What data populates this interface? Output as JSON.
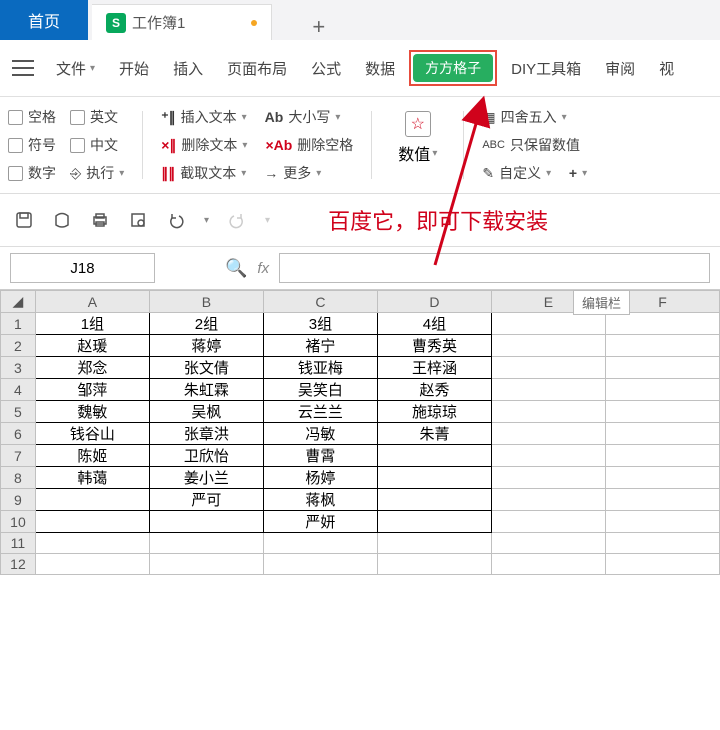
{
  "tabs": {
    "home": "首页",
    "workbook": "工作簿1"
  },
  "menu": {
    "file": "文件",
    "items": [
      "开始",
      "插入",
      "页面布局",
      "公式",
      "数据"
    ],
    "highlighted": "方方格子",
    "rest": [
      "DIY工具箱",
      "审阅",
      "视"
    ]
  },
  "ribbon": {
    "col1": [
      "空格",
      "英文"
    ],
    "col1b": [
      "符号",
      "中文"
    ],
    "col1c": [
      "数字",
      "执行"
    ],
    "col2": [
      "插入文本",
      "大小写"
    ],
    "col2b": [
      "删除文本",
      "删除空格"
    ],
    "col2c": [
      "截取文本",
      "更多"
    ],
    "col3": {
      "main": "数值"
    },
    "col4": [
      "四舍五入",
      "只保留数值",
      "自定义"
    ]
  },
  "annotation": "百度它，即可下载安装",
  "nameBox": "J18",
  "fx": "fx",
  "tooltip": "编辑栏",
  "columns": [
    "A",
    "B",
    "C",
    "D",
    "E",
    "F"
  ],
  "rows": [
    "1",
    "2",
    "3",
    "4",
    "5",
    "6",
    "7",
    "8",
    "9",
    "10",
    "11",
    "12"
  ],
  "data": [
    [
      "1组",
      "2组",
      "3组",
      "4组",
      "",
      ""
    ],
    [
      "赵瑗",
      "蒋婷",
      "褚宁",
      "曹秀英",
      "",
      ""
    ],
    [
      "郑念",
      "张文倩",
      "钱亚梅",
      "王梓涵",
      "",
      ""
    ],
    [
      "邹萍",
      "朱虹霖",
      "吴笑白",
      "赵秀",
      "",
      ""
    ],
    [
      "魏敏",
      "吴枫",
      "云兰兰",
      "施琼琼",
      "",
      ""
    ],
    [
      "钱谷山",
      "张章洪",
      "冯敏",
      "朱菁",
      "",
      ""
    ],
    [
      "陈姬",
      "卫欣怡",
      "曹霄",
      "",
      "",
      ""
    ],
    [
      "韩蔼",
      "姜小兰",
      "杨婷",
      "",
      "",
      ""
    ],
    [
      "",
      "严可",
      "蒋枫",
      "",
      "",
      ""
    ],
    [
      "",
      "",
      "严妍",
      "",
      "",
      ""
    ],
    [
      "",
      "",
      "",
      "",
      "",
      ""
    ],
    [
      "",
      "",
      "",
      "",
      "",
      ""
    ]
  ],
  "dataRange": {
    "rows": 10,
    "cols": 4
  }
}
